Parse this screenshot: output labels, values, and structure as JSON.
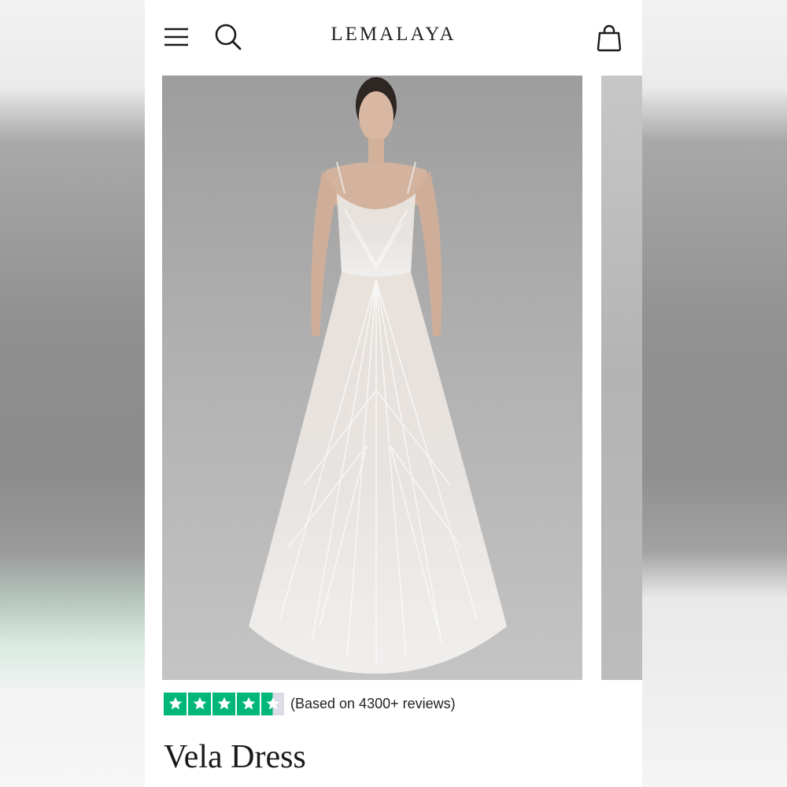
{
  "header": {
    "brand": "LEMALAYA",
    "menu_icon": "hamburger-menu-icon",
    "search_icon": "search-icon",
    "cart_icon": "shopping-bag-icon"
  },
  "gallery": {
    "image_alt": "model-in-white-sequin-gown",
    "background_color": "#b8b8b8"
  },
  "rating": {
    "stars": 4.5,
    "max_stars": 5,
    "star_color": "#00b67a",
    "text": "(Based on 4300+ reviews)"
  },
  "product": {
    "title": "Vela Dress"
  }
}
